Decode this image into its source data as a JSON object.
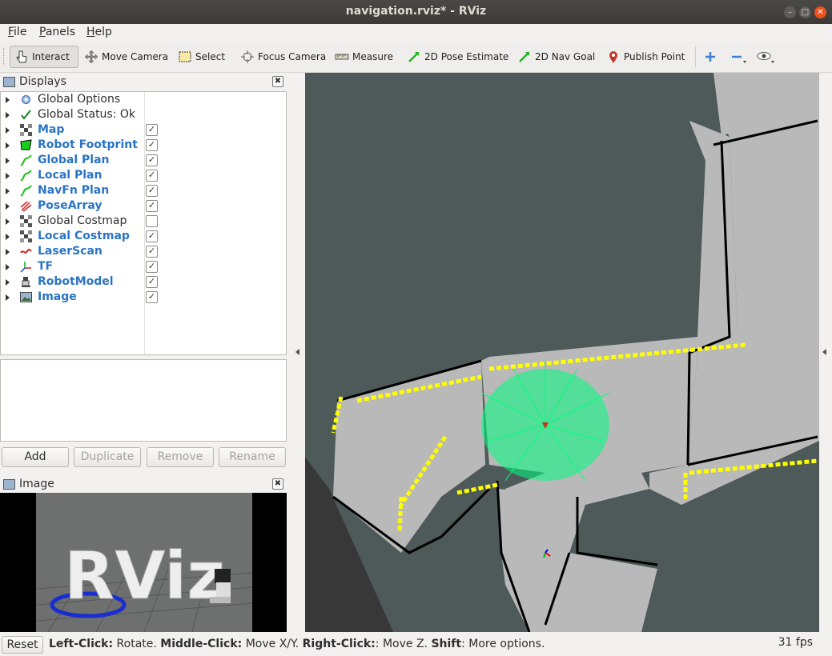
{
  "window": {
    "title": "navigation.rviz* - RViz"
  },
  "menu": {
    "file": "File",
    "file_key": "F",
    "file_rest": "ile",
    "panels_key": "P",
    "panels_rest": "anels",
    "help_key": "H",
    "help_rest": "elp"
  },
  "toolbar": {
    "interact": "Interact",
    "move_camera": "Move Camera",
    "select": "Select",
    "focus_camera": "Focus Camera",
    "measure": "Measure",
    "pose_estimate": "2D Pose Estimate",
    "nav_goal": "2D Nav Goal",
    "publish_point": "Publish Point"
  },
  "displays_panel": {
    "title": "Displays",
    "items": [
      {
        "label": "Global Options",
        "blue": false,
        "checked": null,
        "icon": "gear-icon"
      },
      {
        "label": "Global Status: Ok",
        "blue": false,
        "checked": null,
        "icon": "checkmark-icon"
      },
      {
        "label": "Map",
        "blue": true,
        "checked": true,
        "icon": "grid-map-icon"
      },
      {
        "label": "Robot Footprint",
        "blue": true,
        "checked": true,
        "icon": "polygon-icon"
      },
      {
        "label": "Global Plan",
        "blue": true,
        "checked": true,
        "icon": "path-icon"
      },
      {
        "label": "Local Plan",
        "blue": true,
        "checked": true,
        "icon": "path-icon"
      },
      {
        "label": "NavFn Plan",
        "blue": true,
        "checked": true,
        "icon": "path-icon"
      },
      {
        "label": "PoseArray",
        "blue": true,
        "checked": true,
        "icon": "pose-array-icon"
      },
      {
        "label": "Global Costmap",
        "blue": false,
        "checked": false,
        "icon": "grid-map-icon"
      },
      {
        "label": "Local Costmap",
        "blue": true,
        "checked": true,
        "icon": "grid-map-icon"
      },
      {
        "label": "LaserScan",
        "blue": true,
        "checked": true,
        "icon": "laser-scan-icon"
      },
      {
        "label": "TF",
        "blue": true,
        "checked": true,
        "icon": "tf-axes-icon"
      },
      {
        "label": "RobotModel",
        "blue": true,
        "checked": true,
        "icon": "robot-model-icon"
      },
      {
        "label": "Image",
        "blue": true,
        "checked": true,
        "icon": "image-icon"
      }
    ],
    "buttons": {
      "add": "Add",
      "duplicate": "Duplicate",
      "remove": "Remove",
      "rename": "Rename"
    }
  },
  "image_panel": {
    "title": "Image",
    "logo_text": "RViz"
  },
  "statusbar": {
    "reset": "Reset",
    "hint_parts": [
      {
        "text": "Left-Click:",
        "bold": true
      },
      {
        "text": " Rotate. ",
        "bold": false
      },
      {
        "text": "Middle-Click:",
        "bold": true
      },
      {
        "text": " Move X/Y. ",
        "bold": false
      },
      {
        "text": "Right-Click:",
        "bold": true
      },
      {
        "text": ": Move Z. ",
        "bold": false
      },
      {
        "text": "Shift",
        "bold": true
      },
      {
        "text": ": More options.",
        "bold": false
      }
    ],
    "fps": "31 fps"
  },
  "colors": {
    "viewport_bg": "#4d5a59",
    "free_space": "#b9b9b9",
    "walls": "#000000",
    "laser_points": "#ffff00",
    "pose_arrows": "#00ff7f",
    "link_blue": "#2b74c4"
  }
}
